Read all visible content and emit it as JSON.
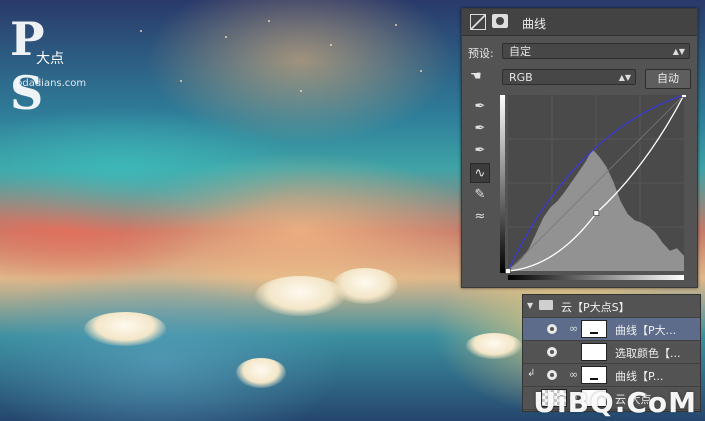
{
  "logo": {
    "mark": "P S",
    "sub": "大点",
    "url": "pdadians.com"
  },
  "curves_panel": {
    "title": "曲线",
    "preset_label": "预设:",
    "preset_value": "自定",
    "channel_value": "RGB",
    "auto_button": "自动",
    "curve_points": [
      [
        0,
        0
      ],
      [
        128,
        84
      ],
      [
        255,
        255
      ]
    ],
    "colors": {
      "curve": "#ffffff",
      "blue_curve": "#3a3ad8",
      "histogram": "#9a9a9a",
      "graph_bg": "#4a4a4a"
    }
  },
  "layers_panel": {
    "group_name": "云【P大点S】",
    "rows": [
      {
        "name": "曲线【P大..."
      },
      {
        "name": "选取颜色【..."
      },
      {
        "name": "曲线【P..."
      },
      {
        "name": "云 大点"
      }
    ]
  },
  "watermark": "UiBQ.CoM"
}
